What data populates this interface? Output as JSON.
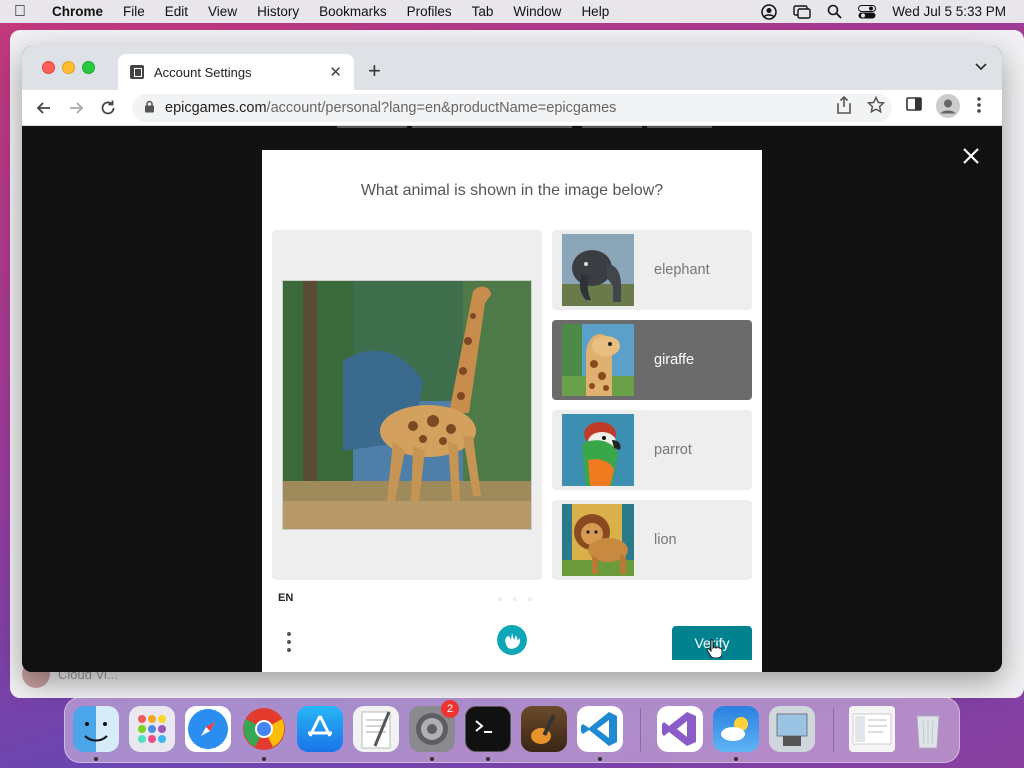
{
  "menubar": {
    "app_name": "Chrome",
    "items": [
      "File",
      "Edit",
      "View",
      "History",
      "Bookmarks",
      "Profiles",
      "Tab",
      "Window",
      "Help"
    ],
    "clock": "Wed Jul 5  5:33 PM"
  },
  "browser": {
    "tab_title": "Account Settings",
    "url_domain": "epicgames.com",
    "url_path": "/account/personal?lang=en&productName=epicgames"
  },
  "captcha": {
    "question": "What animal is shown in the image below?",
    "options": [
      {
        "label": "elephant",
        "selected": false
      },
      {
        "label": "giraffe",
        "selected": true
      },
      {
        "label": "parrot",
        "selected": false
      },
      {
        "label": "lion",
        "selected": false
      }
    ],
    "language": "EN",
    "verify_label": "Verify"
  },
  "background_window": {
    "partial_text": "Cloud Vi..."
  },
  "dock": {
    "settings_badge": "2"
  },
  "colors": {
    "verify_button": "#00838f",
    "selected_option": "#6b6b6b",
    "modal_backdrop": "#111111"
  }
}
